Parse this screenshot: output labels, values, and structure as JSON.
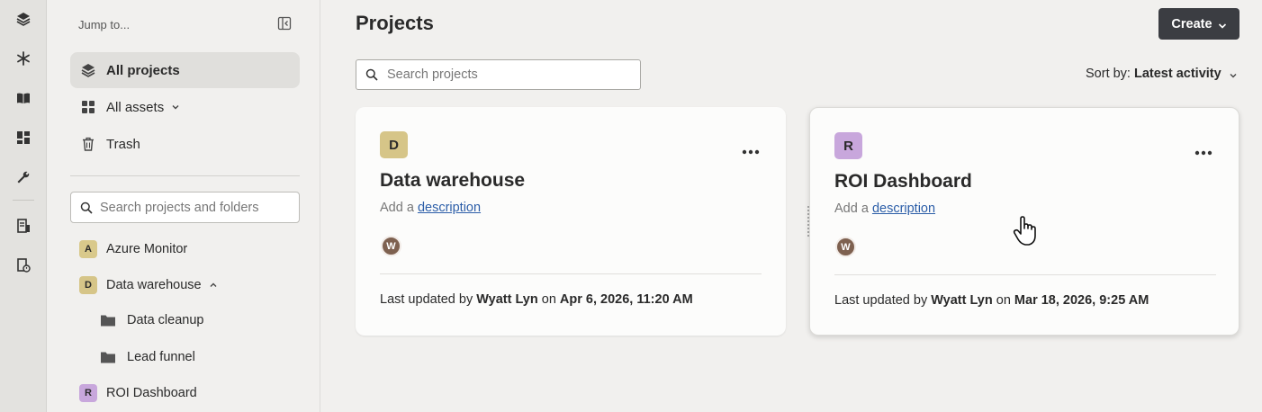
{
  "sidebar": {
    "jump_label": "Jump to...",
    "nav": [
      {
        "label": "All projects"
      },
      {
        "label": "All assets"
      },
      {
        "label": "Trash"
      }
    ],
    "search_placeholder": "Search projects and folders",
    "tree": [
      {
        "badge": "A",
        "label": "Azure Monitor",
        "color": "#d9c98b"
      },
      {
        "badge": "D",
        "label": "Data warehouse",
        "color": "#d6c588"
      },
      {
        "label": "Data cleanup"
      },
      {
        "label": "Lead funnel"
      },
      {
        "badge": "R",
        "label": "ROI Dashboard",
        "color": "#c8a7dc"
      }
    ]
  },
  "header": {
    "title": "Projects",
    "create_label": "Create"
  },
  "toolbar": {
    "search_placeholder": "Search projects",
    "sort_prefix": "Sort by:",
    "sort_value": "Latest activity"
  },
  "cards": [
    {
      "badge": "D",
      "badge_color": "#d6c588",
      "name": "Data warehouse",
      "desc_prefix": "Add a",
      "desc_link": "description",
      "avatar": "W",
      "updated_prefix": "Last updated by",
      "updated_by": "Wyatt Lyn",
      "updated_on": "on",
      "updated_date": "Apr 6, 2026, 11:20 AM"
    },
    {
      "badge": "R",
      "badge_color": "#c8a7dc",
      "name": "ROI Dashboard",
      "desc_prefix": "Add a",
      "desc_link": "description",
      "avatar": "W",
      "updated_prefix": "Last updated by",
      "updated_by": "Wyatt Lyn",
      "updated_on": "on",
      "updated_date": "Mar 18, 2026, 9:25 AM"
    }
  ]
}
